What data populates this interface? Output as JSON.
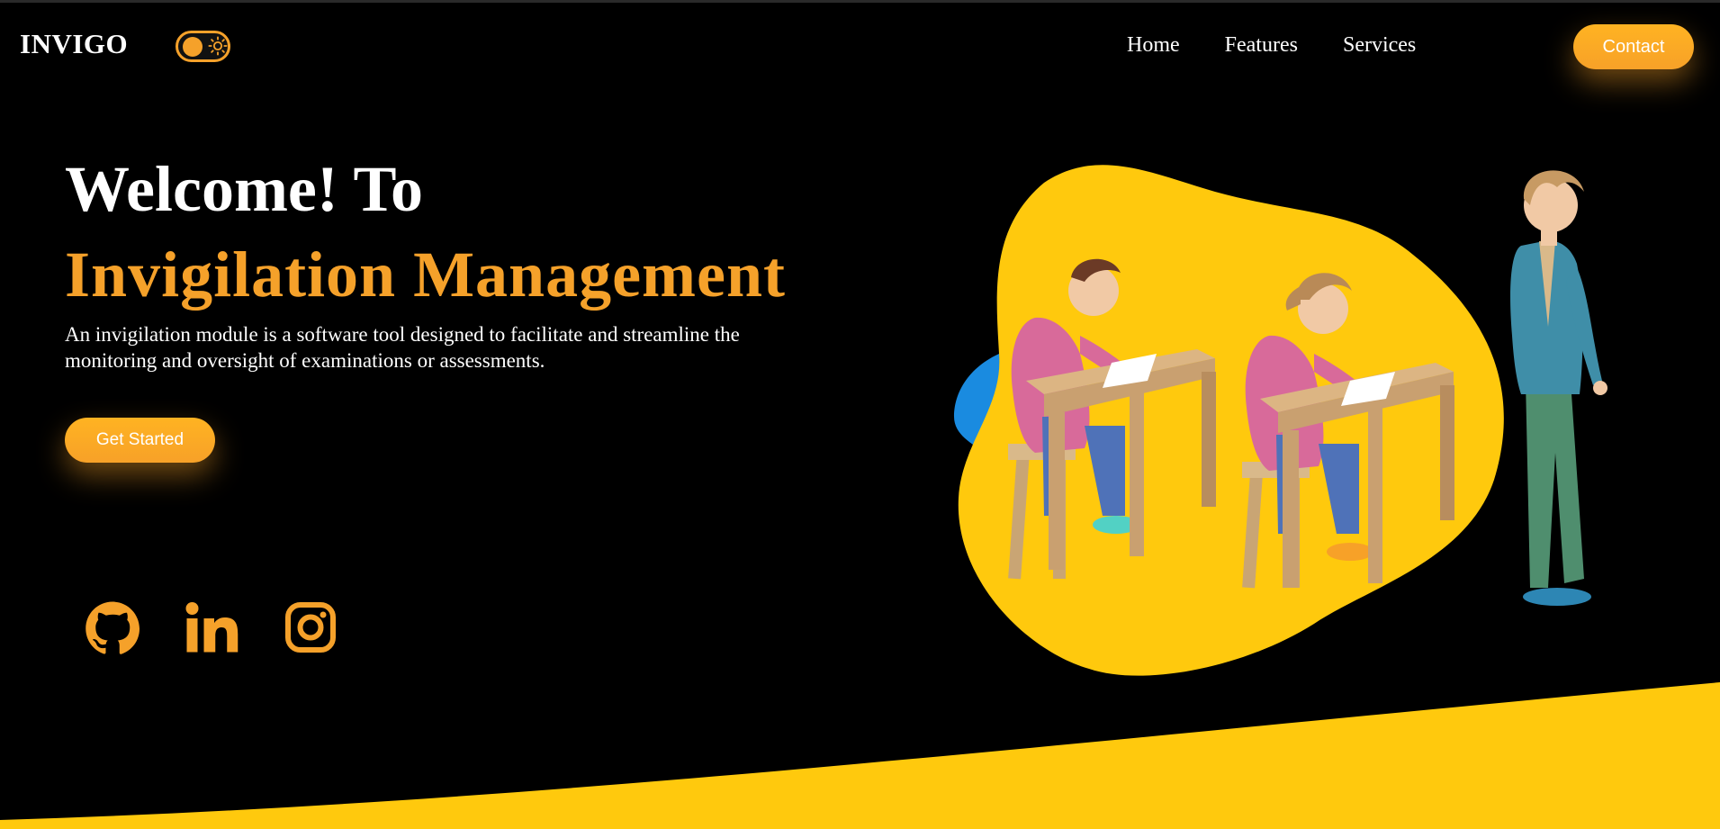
{
  "header": {
    "logo": "INVIGO",
    "theme_toggle_icon": "sun-icon",
    "nav": [
      {
        "label": "Home"
      },
      {
        "label": "Features"
      },
      {
        "label": "Services"
      }
    ],
    "contact_label": "Contact"
  },
  "hero": {
    "title": "Welcome! To",
    "subtitle": "Invigilation Management",
    "description": "An invigilation module is a software tool designed to facilitate and streamline the monitoring and oversight of examinations or assessments.",
    "cta_label": "Get Started"
  },
  "socials": [
    {
      "icon": "github-icon"
    },
    {
      "icon": "linkedin-icon"
    },
    {
      "icon": "instagram-icon"
    }
  ],
  "colors": {
    "background": "#000000",
    "accent": "#f5a12a",
    "blob": "#ffc90d",
    "text": "#ffffff"
  }
}
